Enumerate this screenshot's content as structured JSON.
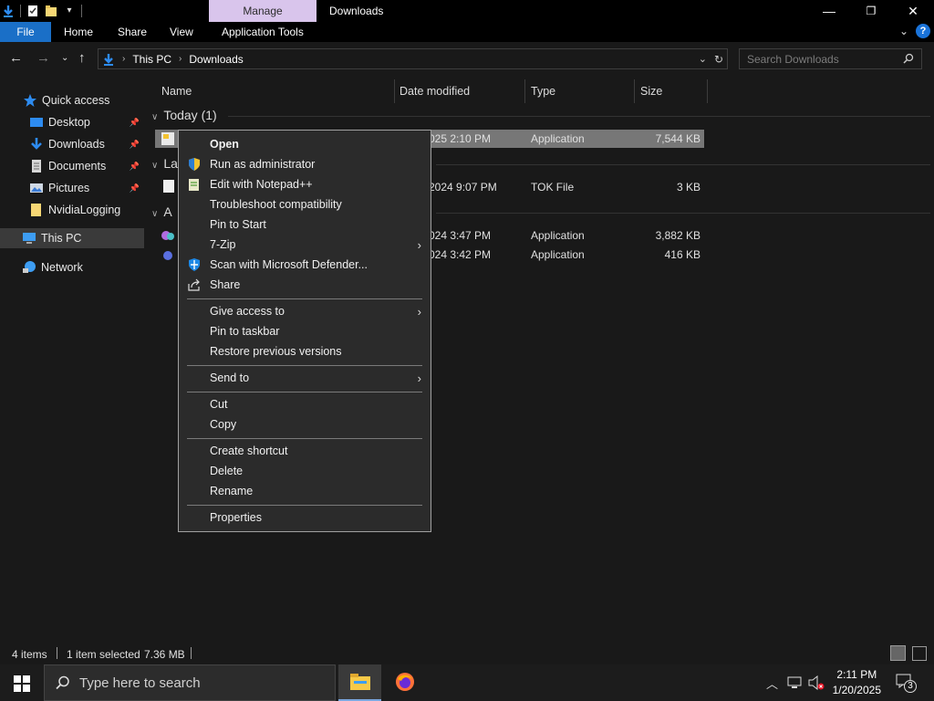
{
  "titlebar": {
    "context_tab": "Manage",
    "title": "Downloads",
    "minimize": "—",
    "maximize": "❐",
    "close": "✕"
  },
  "ribbon": {
    "tabs": [
      "File",
      "Home",
      "Share",
      "View",
      "Application Tools"
    ],
    "help": "?"
  },
  "address": {
    "crumbs": [
      "This PC",
      "Downloads"
    ],
    "search_placeholder": "Search Downloads"
  },
  "nav": {
    "items": [
      {
        "label": "Quick access",
        "icon": "star-icon"
      },
      {
        "label": "Desktop",
        "icon": "desktop-icon",
        "pinned": true
      },
      {
        "label": "Downloads",
        "icon": "download-icon",
        "pinned": true
      },
      {
        "label": "Documents",
        "icon": "document-icon",
        "pinned": true
      },
      {
        "label": "Pictures",
        "icon": "pictures-icon",
        "pinned": true
      },
      {
        "label": "NvidiaLogging",
        "icon": "folder-icon"
      },
      {
        "label": "This PC",
        "icon": "computer-icon",
        "selected": true
      },
      {
        "label": "Network",
        "icon": "network-icon"
      }
    ]
  },
  "columns": [
    "Name",
    "Date modified",
    "Type",
    "Size"
  ],
  "groups": {
    "today": "Today (1)",
    "last": "La",
    "a": "A"
  },
  "rows": [
    {
      "date": "025 2:10 PM",
      "type": "Application",
      "size": "7,544 KB",
      "selected": true
    },
    {
      "date": "2024 9:07 PM",
      "type": "TOK File",
      "size": "3 KB"
    },
    {
      "date": "024 3:47 PM",
      "type": "Application",
      "size": "3,882 KB"
    },
    {
      "date": "024 3:42 PM",
      "type": "Application",
      "size": "416 KB"
    }
  ],
  "context_menu": {
    "items": [
      "Open",
      "Run as administrator",
      "Edit with Notepad++",
      "Troubleshoot compatibility",
      "Pin to Start",
      "7-Zip",
      "Scan with Microsoft Defender...",
      "Share",
      "Give access to",
      "Pin to taskbar",
      "Restore previous versions",
      "Send to",
      "Cut",
      "Copy",
      "Create shortcut",
      "Delete",
      "Rename",
      "Properties"
    ]
  },
  "status": {
    "count": "4 items",
    "selected": "1 item selected",
    "size": "7.36 MB"
  },
  "taskbar": {
    "search_placeholder": "Type here to search",
    "time": "2:11 PM",
    "date": "1/20/2025",
    "notifications": "3"
  },
  "colors": {
    "accent": "#1a6fc7",
    "manage_tab": "#d9c5ec",
    "background": "#191919"
  }
}
